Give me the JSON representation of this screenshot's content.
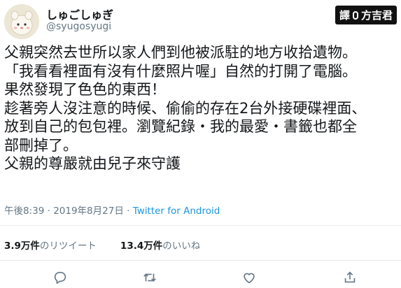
{
  "user": {
    "display_name": "しゅごしゅぎ",
    "handle": "@syugosyugi"
  },
  "watermark": {
    "left_text": "譯",
    "right_text": "方吉君"
  },
  "tweet": {
    "lines": [
      "父親突然去世所以家人們到他被派駐的地方收拾遺物。",
      "「我看看裡面有沒有什麼照片喔」自然的打開了電腦。",
      "果然發現了色色的東西！",
      "趁著旁人沒注意的時候、偷偷的存在2台外接硬碟裡面、",
      "放到自己的包包裡。瀏覽紀錄・我的最愛・書籤也都全",
      "部刪掉了。",
      "父親的尊嚴就由兒子來守護"
    ]
  },
  "meta": {
    "time": "午後8:39",
    "sep1": " · ",
    "date": "2019年8月27日",
    "sep2": " · ",
    "source": "Twitter for Android"
  },
  "stats": {
    "retweets_count": "3.9万件",
    "retweets_label": "のリツイート",
    "likes_count": "13.4万件",
    "likes_label": "のいいね"
  },
  "actions": {
    "icons": [
      "reply-icon",
      "retweet-icon",
      "like-icon",
      "share-icon"
    ]
  },
  "colors": {
    "text": "#14171a",
    "muted": "#657786",
    "link": "#1b95e0",
    "divider": "#e6ecf0"
  }
}
